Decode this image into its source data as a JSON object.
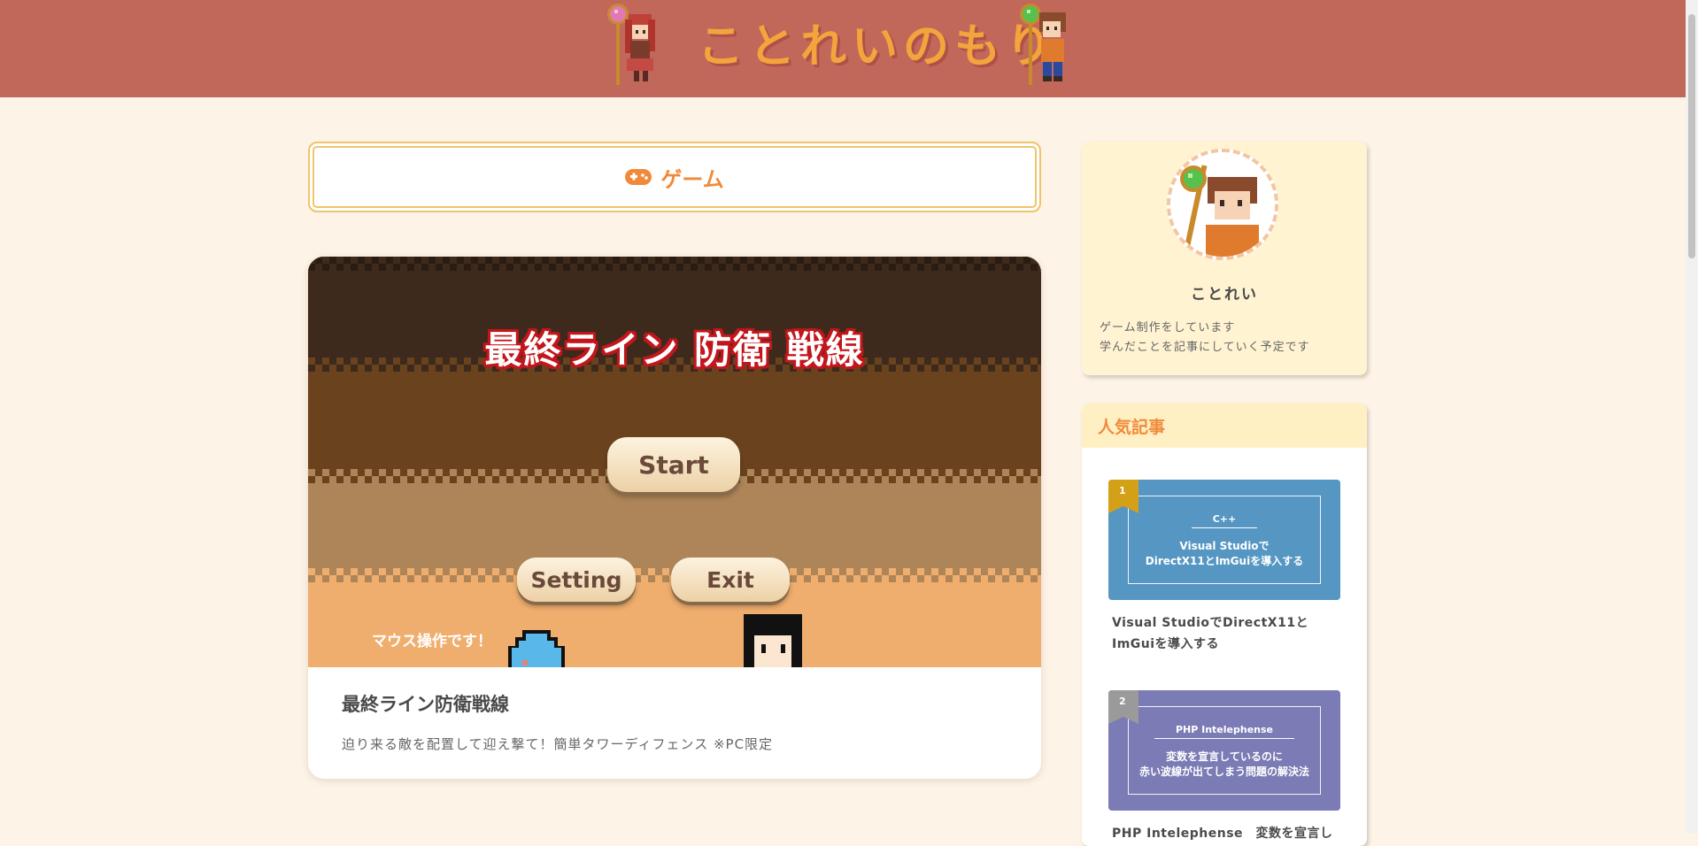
{
  "header": {
    "site_title": "ことれいのもり"
  },
  "category": {
    "label": "ゲーム",
    "icon": "gamepad-icon"
  },
  "article": {
    "thumbnail": {
      "game_title": "最終ライン 防衛 戦線",
      "start_label": "Start",
      "setting_label": "Setting",
      "exit_label": "Exit",
      "mouse_note": "マウス操作です！"
    },
    "title": "最終ライン防衛戦線",
    "description": "迫り来る敵を配置して迎え撃て！簡単タワーディフェンス ※PC限定"
  },
  "sidebar": {
    "profile": {
      "name": "ことれい",
      "bio_line1": "ゲーム制作をしています",
      "bio_line2": "学んだことを記事にしていく予定です"
    },
    "popular": {
      "heading": "人気記事",
      "items": [
        {
          "rank": "1",
          "tag": "C++",
          "thumb_line1": "Visual Studioで",
          "thumb_line2": "DirectX11とImGuiを導入する",
          "title": "Visual StudioでDirectX11とImGuiを導入する",
          "color": "#5596c2",
          "badge_color": "#d4a017"
        },
        {
          "rank": "2",
          "tag": "PHP Intelephense",
          "thumb_line1": "変数を宣言しているのに",
          "thumb_line2": "赤い波線が出てしまう問題の解決法",
          "title": "PHP Intelephense　変数を宣言し",
          "color": "#7b7bb5",
          "badge_color": "#9a9a9a"
        }
      ]
    }
  }
}
